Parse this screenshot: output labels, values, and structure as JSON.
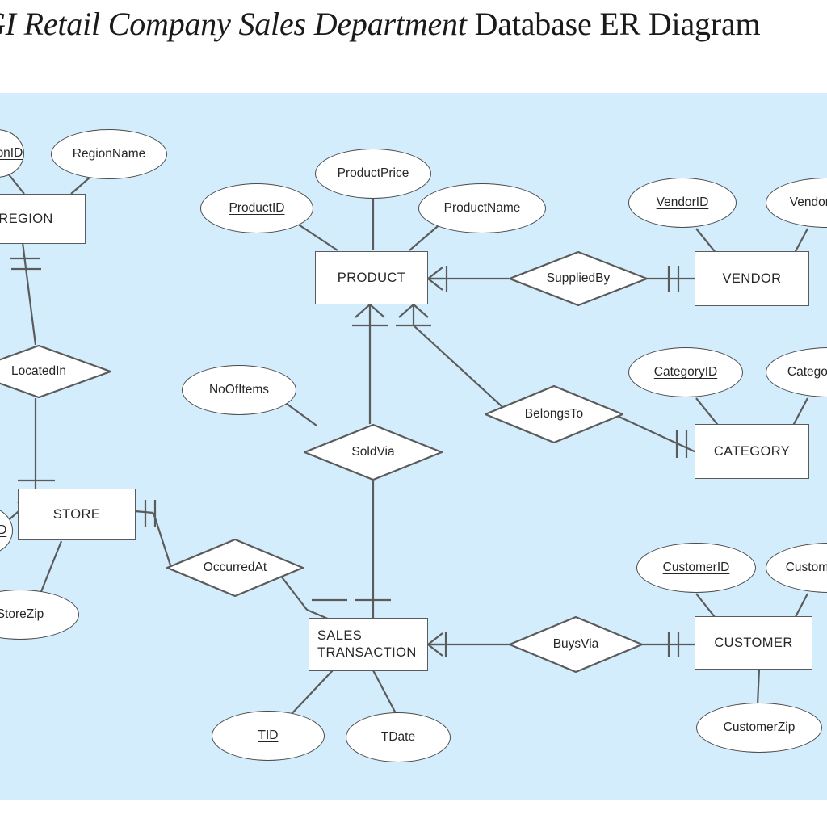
{
  "title": {
    "italic_part": "GI Retail Company Sales Department ",
    "roman_part": "Database ER Diagram",
    "full_text": "GI Retail Company Sales Department Database ER Diagram"
  },
  "canvas": {
    "background_color": "#d3edfc",
    "shape_fill": "#ffffff",
    "shape_stroke": "#5b5b5b",
    "text_color": "#262626"
  },
  "notation": "crows-foot",
  "entities": {
    "region": {
      "name": "REGION",
      "attributes": [
        {
          "label": "RegionID",
          "primary_key": true
        },
        {
          "label": "RegionName",
          "primary_key": false
        }
      ]
    },
    "store": {
      "name": "STORE",
      "attributes": [
        {
          "label": "StoreID",
          "primary_key": true
        },
        {
          "label": "StoreZip",
          "primary_key": false
        }
      ]
    },
    "product": {
      "name": "PRODUCT",
      "attributes": [
        {
          "label": "ProductID",
          "primary_key": true
        },
        {
          "label": "ProductPrice",
          "primary_key": false
        },
        {
          "label": "ProductName",
          "primary_key": false
        }
      ]
    },
    "vendor": {
      "name": "VENDOR",
      "attributes": [
        {
          "label": "VendorID",
          "primary_key": true
        },
        {
          "label": "VendorName",
          "primary_key": false
        }
      ]
    },
    "category": {
      "name": "CATEGORY",
      "attributes": [
        {
          "label": "CategoryID",
          "primary_key": true
        },
        {
          "label": "CategoryName",
          "primary_key": false
        }
      ]
    },
    "customer": {
      "name": "CUSTOMER",
      "attributes": [
        {
          "label": "CustomerID",
          "primary_key": true
        },
        {
          "label": "CustomerName",
          "primary_key": false
        },
        {
          "label": "CustomerZip",
          "primary_key": false
        }
      ]
    },
    "sales_transaction": {
      "name": "SALES\nTRANSACTION",
      "attributes": [
        {
          "label": "TID",
          "primary_key": true
        },
        {
          "label": "TDate",
          "primary_key": false
        }
      ]
    }
  },
  "relationships": [
    {
      "label": "LocatedIn",
      "from": "REGION",
      "to": "STORE",
      "from_cardinality": "one-and-only-one",
      "to_cardinality": "one-to-many",
      "attributes": []
    },
    {
      "label": "SuppliedBy",
      "from": "PRODUCT",
      "to": "VENDOR",
      "from_cardinality": "one-to-many",
      "to_cardinality": "one-and-only-one",
      "attributes": []
    },
    {
      "label": "SoldVia",
      "from": "PRODUCT",
      "to": "SALES TRANSACTION",
      "from_cardinality": "one-to-many",
      "to_cardinality": "one-to-many",
      "attributes": [
        {
          "label": "NoOfItems",
          "primary_key": false
        }
      ]
    },
    {
      "label": "BelongsTo",
      "from": "PRODUCT",
      "to": "CATEGORY",
      "from_cardinality": "one-to-many",
      "to_cardinality": "one-and-only-one",
      "attributes": []
    },
    {
      "label": "OccurredAt",
      "from": "STORE",
      "to": "SALES TRANSACTION",
      "from_cardinality": "one-and-only-one",
      "to_cardinality": "one-to-many",
      "attributes": []
    },
    {
      "label": "BuysVia",
      "from": "SALES TRANSACTION",
      "to": "CUSTOMER",
      "from_cardinality": "one-to-many",
      "to_cardinality": "one-and-only-one",
      "attributes": []
    }
  ]
}
